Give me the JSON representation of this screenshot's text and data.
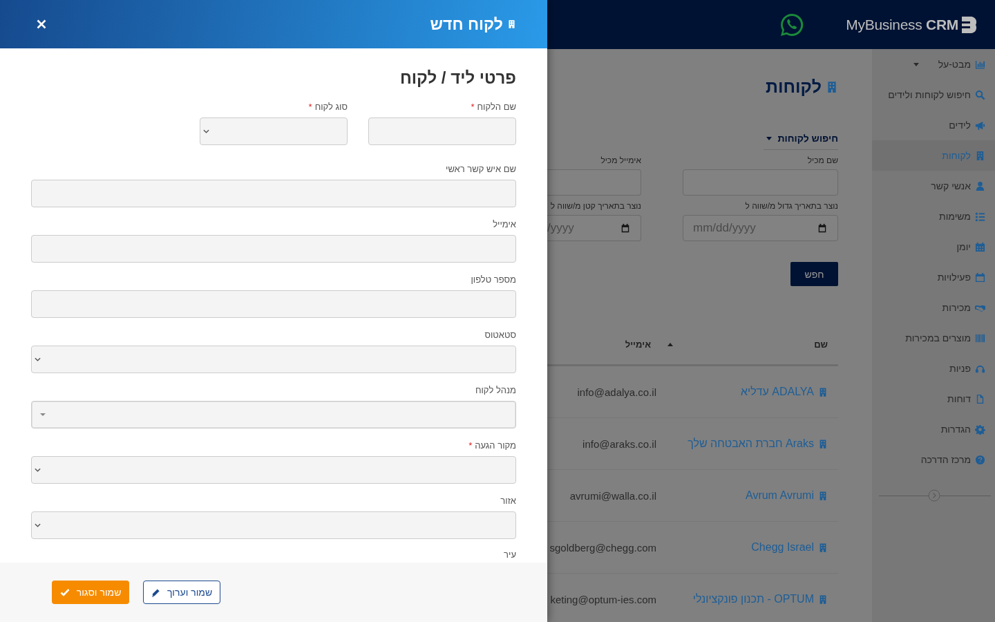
{
  "app": {
    "logo": {
      "name": "MyBusiness",
      "suffix": "CRM"
    },
    "sidebar": {
      "items": [
        {
          "label": "מבט-על",
          "selected": false,
          "expandable": true
        },
        {
          "label": "חיפוש לקוחות ולידים",
          "selected": false,
          "expandable": false
        },
        {
          "label": "לידים",
          "selected": false,
          "expandable": false
        },
        {
          "label": "לקוחות",
          "selected": true,
          "expandable": false
        },
        {
          "label": "אנשי קשר",
          "selected": false,
          "expandable": false
        },
        {
          "label": "משימות",
          "selected": false,
          "expandable": false
        },
        {
          "label": "יומן",
          "selected": false,
          "expandable": false
        },
        {
          "label": "פעילויות",
          "selected": false,
          "expandable": false
        },
        {
          "label": "מכירות",
          "selected": false,
          "expandable": false
        },
        {
          "label": "מוצרים במכירות",
          "selected": false,
          "expandable": false
        },
        {
          "label": "פניות",
          "selected": false,
          "expandable": false
        },
        {
          "label": "דוחות",
          "selected": false,
          "expandable": false
        },
        {
          "label": "הגדרות",
          "selected": false,
          "expandable": false
        },
        {
          "label": "מרכז הדרכה",
          "selected": false,
          "expandable": false
        }
      ]
    },
    "page_title": "לקוחות",
    "search_panel": {
      "title": "חיפוש לקוחות",
      "expanded": true,
      "fields": [
        {
          "label": "שם מכיל",
          "kind": "text"
        },
        {
          "label": "אימייל מכיל",
          "kind": "text"
        },
        {
          "label": "נוצר בתאריך גדול מ/שווה ל",
          "kind": "date",
          "placeholder": "mm/dd/yyyy"
        },
        {
          "label": "נוצר בתאריך קטן מ/שווה ל",
          "kind": "date",
          "placeholder": "/yyyy"
        }
      ],
      "button": "חפש"
    },
    "table": {
      "columns": [
        {
          "label": "שם",
          "sorted": false
        },
        {
          "label": "אימייל",
          "sorted": true
        }
      ],
      "rows": [
        {
          "name": "ADALYA עדליא",
          "email": "info@adalya.co.il"
        },
        {
          "name": "Araks חברת האבטחה שלך",
          "email": "info@araks.co.il"
        },
        {
          "name": "Avrum Avrumi",
          "email": "avrumi@walla.co.il"
        },
        {
          "name": "Chegg Israel",
          "email": "sgoldberg@chegg.com"
        },
        {
          "name": "OPTUM - תכנון פונקציונלי",
          "email": "keting@optum-ies.com"
        }
      ]
    }
  },
  "drawer": {
    "title": "לקוח חדש",
    "section_title": "פרטי ליד / לקוח",
    "field_rows": [
      [
        {
          "label": "שם הלקוח",
          "required": true,
          "kind": "text"
        },
        {
          "label": "סוג לקוח",
          "required": true,
          "kind": "select"
        }
      ],
      [
        {
          "label": "שם איש קשר ראשי",
          "required": false,
          "kind": "text"
        }
      ],
      [
        {
          "label": "אימייל",
          "required": false,
          "kind": "text"
        }
      ],
      [
        {
          "label": "מספר טלפון",
          "required": false,
          "kind": "text"
        }
      ],
      [
        {
          "label": "סטאטוס",
          "required": false,
          "kind": "select"
        }
      ],
      [
        {
          "label": "מנהל לקוח",
          "required": false,
          "kind": "combo"
        }
      ],
      [
        {
          "label": "מקור הגעה",
          "required": true,
          "kind": "select"
        }
      ],
      [
        {
          "label": "אזור",
          "required": false,
          "kind": "select"
        }
      ]
    ],
    "cut_label": "עיר",
    "required_mark": "*",
    "buttons": [
      {
        "label": "שמור וערוך",
        "kind": "outline"
      },
      {
        "label": "שמור וסגור",
        "kind": "primary"
      }
    ]
  }
}
